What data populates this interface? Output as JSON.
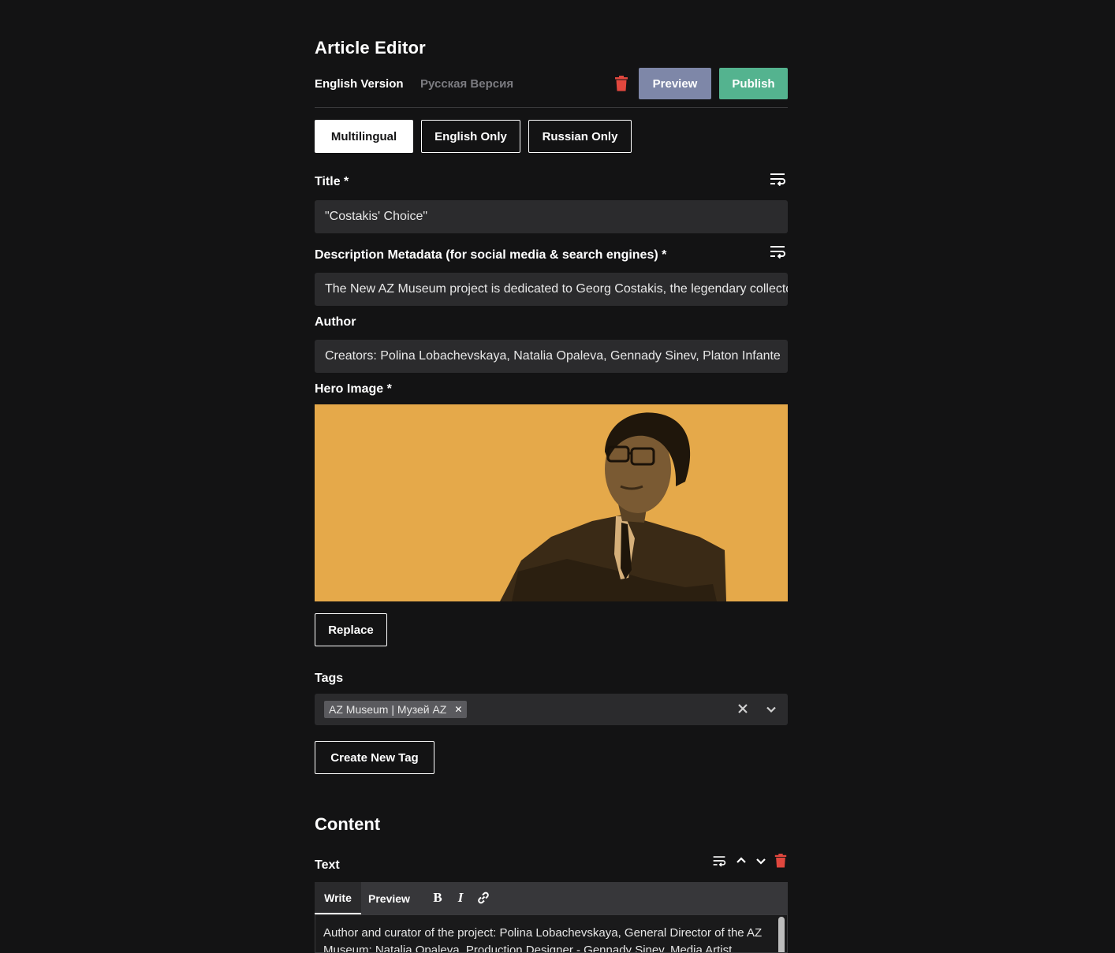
{
  "header": {
    "title": "Article Editor"
  },
  "lang_tabs": {
    "english": "English Version",
    "russian": "Русская Версия"
  },
  "actions": {
    "preview": "Preview",
    "publish": "Publish"
  },
  "modes": [
    "Multilingual",
    "English Only",
    "Russian Only"
  ],
  "fields": {
    "title": {
      "label": "Title *",
      "value": "\"Costakis' Choice\""
    },
    "description": {
      "label": "Description Metadata (for social media & search engines) *",
      "value": "The New AZ Museum project is dedicated to Georg Costakis, the legendary collector of Russian avant-garde art"
    },
    "author": {
      "label": "Author",
      "value": "Creators: Polina Lobachevskaya, Natalia Opaleva, Gennady Sinev, Platon Infante"
    },
    "hero": {
      "label": "Hero Image *",
      "replace": "Replace"
    },
    "tags": {
      "label": "Tags",
      "items": [
        "AZ Museum | Музей AZ"
      ],
      "create": "Create New Tag"
    }
  },
  "content": {
    "heading": "Content",
    "block_label": "Text",
    "editor_tabs": {
      "write": "Write",
      "preview": "Preview"
    },
    "format": {
      "bold": "B",
      "italic": "I"
    },
    "text": "Author and curator of the project: Polina Lobachevskaya, General Director of the AZ Museum; Natalia Opaleva, Production Designer - Gennady Sinev, Media Artist"
  },
  "colors": {
    "background": "#131314",
    "field": "#2b2b2d",
    "preview_btn": "#7e87a8",
    "publish_btn": "#54b38f",
    "danger": "#e0473e",
    "hero_bg": "#e5a94a"
  }
}
